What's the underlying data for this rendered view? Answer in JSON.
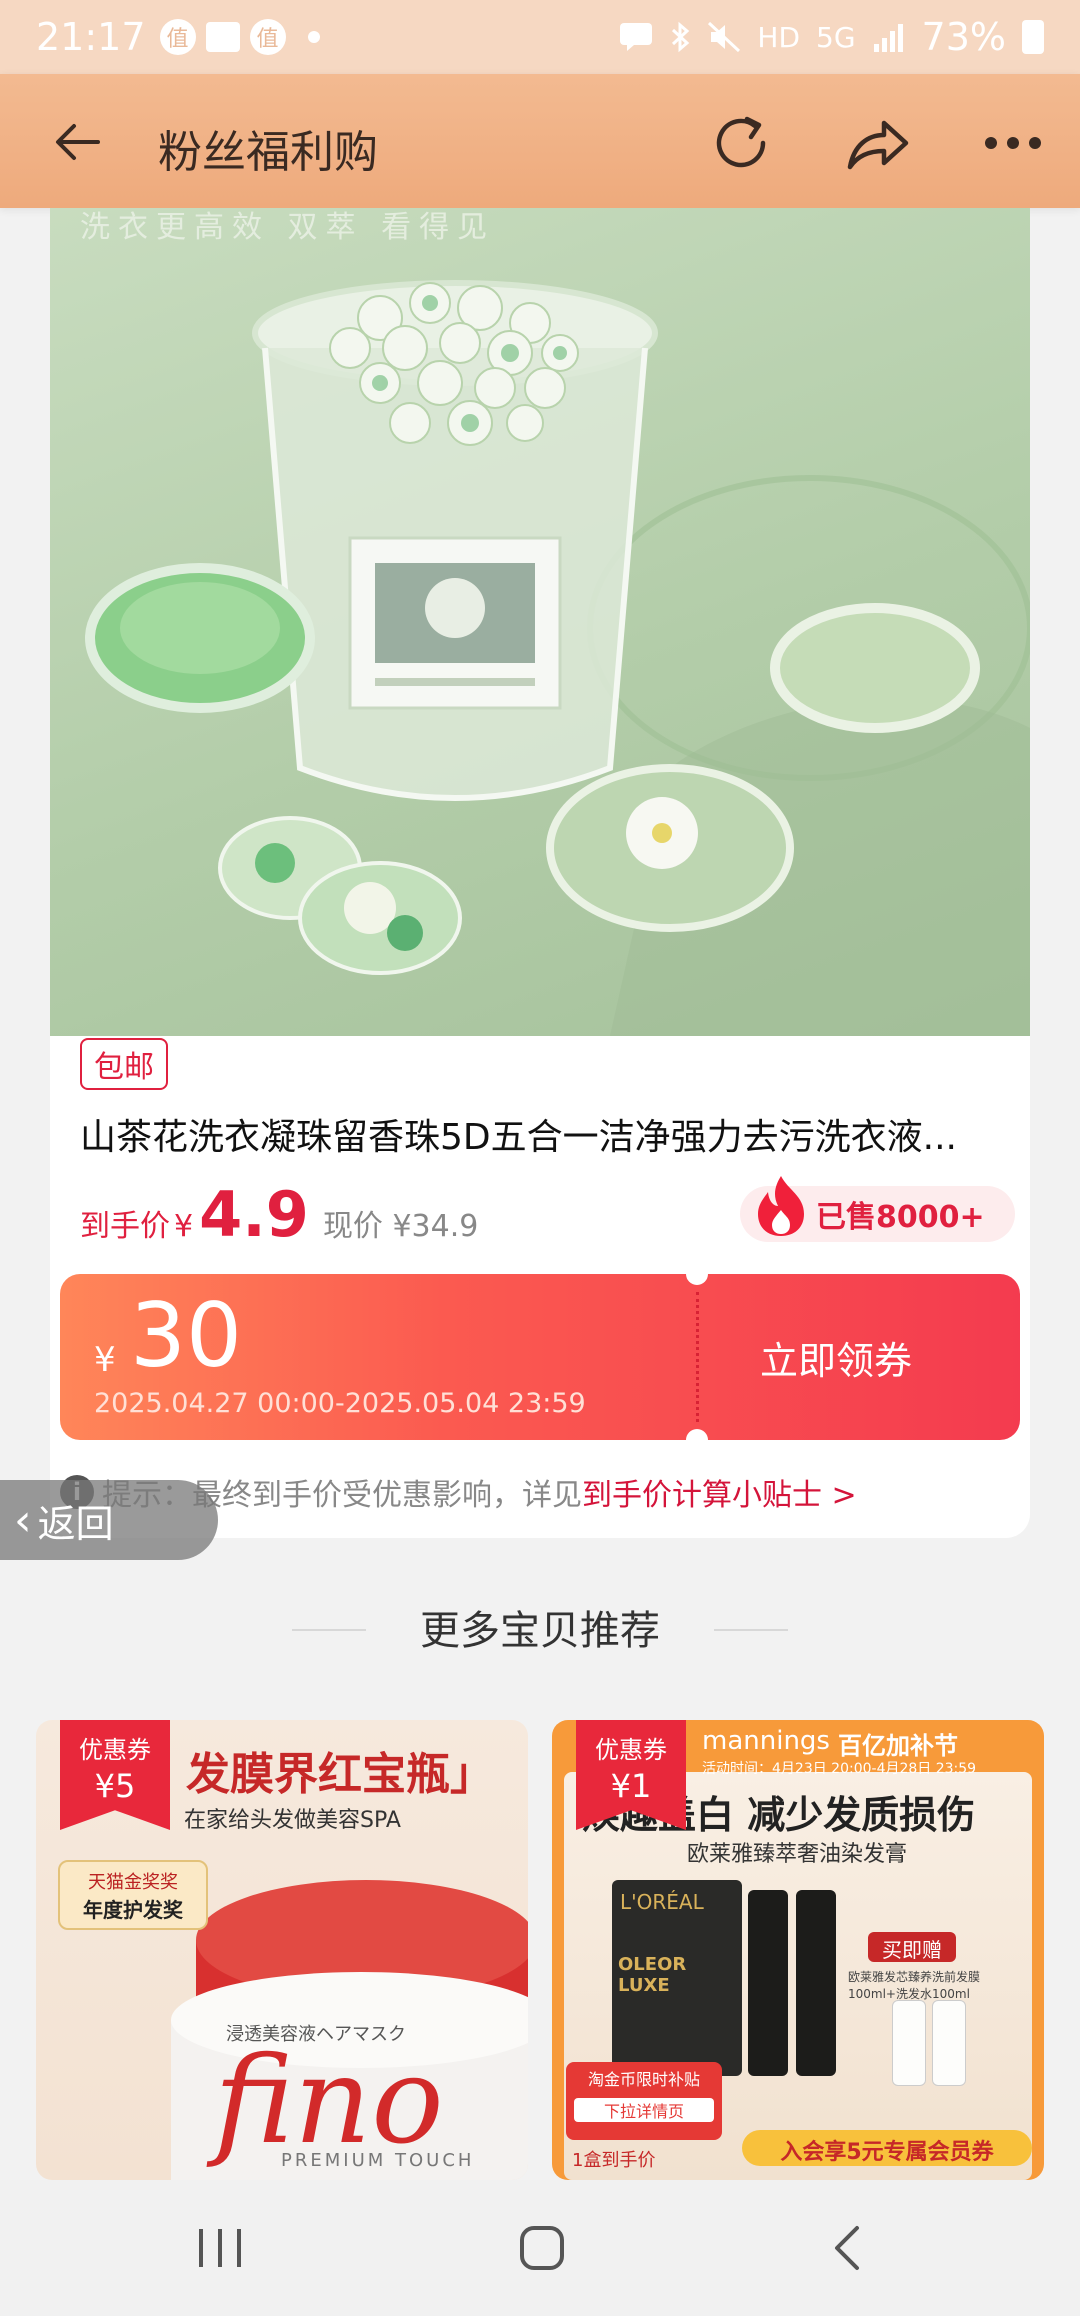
{
  "status_bar": {
    "time": "21:17",
    "notif_badge": "值",
    "network": "HD",
    "network_gen": "5G",
    "battery": "73%"
  },
  "header": {
    "title": "粉丝福利购",
    "icons": [
      "back-arrow-icon",
      "refresh-icon",
      "share-icon",
      "more-icon"
    ]
  },
  "product": {
    "image_caption": "洗衣更高效  双萃  看得见",
    "tag": "包邮",
    "title": "山茶花洗衣凝珠留香珠5D五合一洁净强力去污洗衣液...",
    "price_label": "到手价",
    "currency": "¥",
    "final_price": "4.9",
    "original_price": "现价 ¥34.9",
    "sold": "已售8000+"
  },
  "coupon": {
    "currency": "¥",
    "amount": "30",
    "validity": "2025.04.27 00:00-2025.05.04 23:59",
    "action": "立即领券"
  },
  "tip": {
    "prefix": "提示：最终到手价受优惠影响，详见",
    "link": "到手价计算小贴士 >"
  },
  "float_back": "返回",
  "more_section": {
    "title": "更多宝贝推荐",
    "items": [
      {
        "coupon_label": "优惠券",
        "coupon_value": "¥5",
        "headline": "发膜界红宝瓶」",
        "subline": "在家给头发做美容SPA",
        "badge_top": "天猫金奖奖",
        "badge_bottom": "年度护发奖",
        "brand": "fino",
        "brand_sub": "PREMIUM TOUCH",
        "jp_text": "浸透美容液ヘアマスク"
      },
      {
        "coupon_label": "优惠券",
        "coupon_value": "¥1",
        "store": "mannings",
        "event": "百亿加补节",
        "event_time": "活动时间：4月23日 20:00-4月28日 23:59",
        "headline": "焕趣盖白 减少发质损伤",
        "subline": "欧莱雅臻萃奢油染发膏",
        "brand": "L'ORÉAL",
        "product_line": "OLEOR LUXE",
        "gift_label": "买即赠",
        "gift_desc": "欧莱雅发芯臻养洗前发膜100ml+洗发水100ml",
        "subsidy": "淘金币限时补贴",
        "promo": "下拉详情页",
        "member": "入会享5元专属会员券",
        "qty": "1盒到手价"
      }
    ]
  },
  "nav": {
    "icons": [
      "recent-apps-icon",
      "home-icon",
      "back-icon"
    ]
  },
  "colors": {
    "accent": "#e0203f",
    "header_bg": "#f0b084",
    "coupon_start": "#ff8659",
    "coupon_end": "#f43b4f"
  }
}
